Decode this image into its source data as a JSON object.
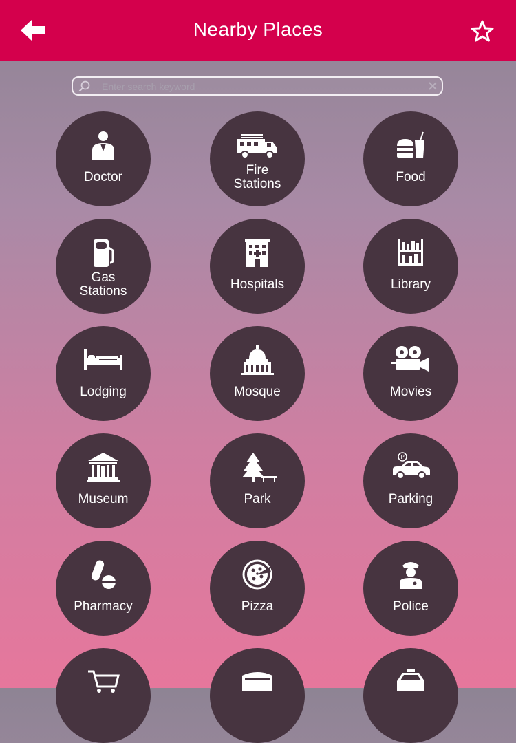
{
  "header": {
    "title": "Nearby Places",
    "back_icon": "arrow-left-icon",
    "favorite_icon": "star-outline-icon",
    "color": "#d4004c"
  },
  "search": {
    "placeholder": "Enter search keyword",
    "value": "",
    "icon": "search-icon",
    "clear_icon": "clear-icon"
  },
  "categories": [
    {
      "label": "Doctor",
      "icon": "doctor-icon"
    },
    {
      "label": "Fire\nStations",
      "icon": "fire-truck-icon"
    },
    {
      "label": "Food",
      "icon": "burger-drink-icon"
    },
    {
      "label": "Gas\nStations",
      "icon": "gas-pump-icon"
    },
    {
      "label": "Hospitals",
      "icon": "hospital-building-icon"
    },
    {
      "label": "Library",
      "icon": "bookshelf-icon"
    },
    {
      "label": "Lodging",
      "icon": "bed-icon"
    },
    {
      "label": "Mosque",
      "icon": "dome-building-icon"
    },
    {
      "label": "Movies",
      "icon": "film-projector-icon"
    },
    {
      "label": "Museum",
      "icon": "museum-building-icon"
    },
    {
      "label": "Park",
      "icon": "tree-bench-icon"
    },
    {
      "label": "Parking",
      "icon": "car-parking-icon"
    },
    {
      "label": "Pharmacy",
      "icon": "pill-icon"
    },
    {
      "label": "Pizza",
      "icon": "pizza-icon"
    },
    {
      "label": "Police",
      "icon": "police-officer-icon"
    },
    {
      "label": "",
      "icon": "shopping-cart-icon"
    },
    {
      "label": "",
      "icon": "stadium-icon"
    },
    {
      "label": "",
      "icon": "taxi-icon"
    }
  ]
}
